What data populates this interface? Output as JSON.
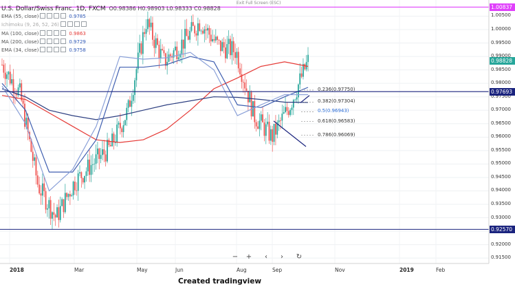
{
  "header": {
    "symbol": "U.S. Dollar/Swiss Franc, 1D, FXCM",
    "ohlc": "O0.98386 H0.98903 L0.98333 C0.98828",
    "exit_fullscreen": "Exit Full Screen (ESC)",
    "indicators": [
      {
        "label": "EMA (55, close)",
        "value": "0.9785",
        "color": "#5b7fc7"
      },
      {
        "label": "Ichimoku (9, 26, 52, 26)",
        "value": "",
        "color": "#aaaaaa"
      },
      {
        "label": "MA (100, close)",
        "value": "0.9863",
        "color": "#e53935"
      },
      {
        "label": "MA (200, close)",
        "value": "0.9729",
        "color": "#2c3e80"
      },
      {
        "label": "EMA (34, close)",
        "value": "0.9758",
        "color": "#5b7fc7"
      }
    ]
  },
  "price_labels": [
    {
      "text": "1.00837",
      "color": "#e040fb"
    },
    {
      "text": "0.98828",
      "color": "#26a69a"
    },
    {
      "text": "0.97693",
      "color": "#1a237e"
    },
    {
      "text": "0.92570",
      "color": "#1a237e"
    }
  ],
  "fib_labels": [
    {
      "text": "0.236(0.97750)",
      "color": "#333333"
    },
    {
      "text": "0.382(0.97304)",
      "color": "#333333"
    },
    {
      "text": "0.5(0.96943)",
      "color": "#2e6fd8"
    },
    {
      "text": "0.618(0.96583)",
      "color": "#333333"
    },
    {
      "text": "0.786(0.96069)",
      "color": "#333333"
    }
  ],
  "y_ticks": [
    "1.00500",
    "1.00000",
    "0.99500",
    "0.99000",
    "0.98500",
    "0.98000",
    "0.97500",
    "0.97000",
    "0.96500",
    "0.96000",
    "0.95500",
    "0.95000",
    "0.94500",
    "0.94000",
    "0.93500",
    "0.93000",
    "0.92500",
    "0.92000",
    "0.91500"
  ],
  "x_ticks": [
    {
      "text": "2018",
      "bold": true
    },
    {
      "text": "Mar",
      "bold": false
    },
    {
      "text": "May",
      "bold": false
    },
    {
      "text": "Jun",
      "bold": false
    },
    {
      "text": "Aug",
      "bold": false
    },
    {
      "text": "Sep",
      "bold": false
    },
    {
      "text": "Nov",
      "bold": false
    },
    {
      "text": "2019",
      "bold": true
    },
    {
      "text": "Feb",
      "bold": false
    }
  ],
  "nav_buttons": [
    "−",
    "+",
    "‹",
    "›",
    "↻"
  ],
  "caption": "Created tradingview",
  "chart_data": {
    "type": "line",
    "title": "U.S. Dollar/Swiss Franc, 1D, FXCM",
    "ylim": [
      0.913,
      1.011
    ],
    "candle_up_color": "#26a69a",
    "candle_down_color": "#ef5350",
    "series": [
      {
        "name": "MA (100, close)",
        "color": "#e53935",
        "values": [
          0.9755,
          0.974,
          0.969,
          0.964,
          0.959,
          0.958,
          0.959,
          0.963,
          0.97,
          0.978,
          0.982,
          0.9863,
          0.988,
          0.9863
        ]
      },
      {
        "name": "MA (200, close)",
        "color": "#2c3e80",
        "values": [
          0.978,
          0.975,
          0.97,
          0.968,
          0.9665,
          0.968,
          0.97,
          0.972,
          0.9735,
          0.975,
          0.9748,
          0.974,
          0.973,
          0.9729
        ]
      },
      {
        "name": "EMA (55, close)",
        "color": "#3f5fb0",
        "values": [
          0.98,
          0.97,
          0.947,
          0.947,
          0.959,
          0.986,
          0.986,
          0.987,
          0.99,
          0.988,
          0.972,
          0.971,
          0.975,
          0.9785
        ]
      },
      {
        "name": "EMA (34, close)",
        "color": "#8aa0d8",
        "values": [
          0.979,
          0.965,
          0.94,
          0.948,
          0.964,
          0.99,
          0.989,
          0.9895,
          0.9915,
          0.985,
          0.968,
          0.972,
          0.9758,
          0.9758
        ]
      }
    ],
    "candles_close": [
      0.987,
      0.976,
      0.942,
      0.93,
      0.943,
      0.95,
      0.956,
      0.97,
      1.003,
      0.988,
      0.995,
      1.003,
      0.994,
      0.992,
      0.968,
      0.96,
      0.972,
      0.9883
    ],
    "horizontal_levels": [
      1.00837,
      0.97693,
      0.9257
    ]
  }
}
